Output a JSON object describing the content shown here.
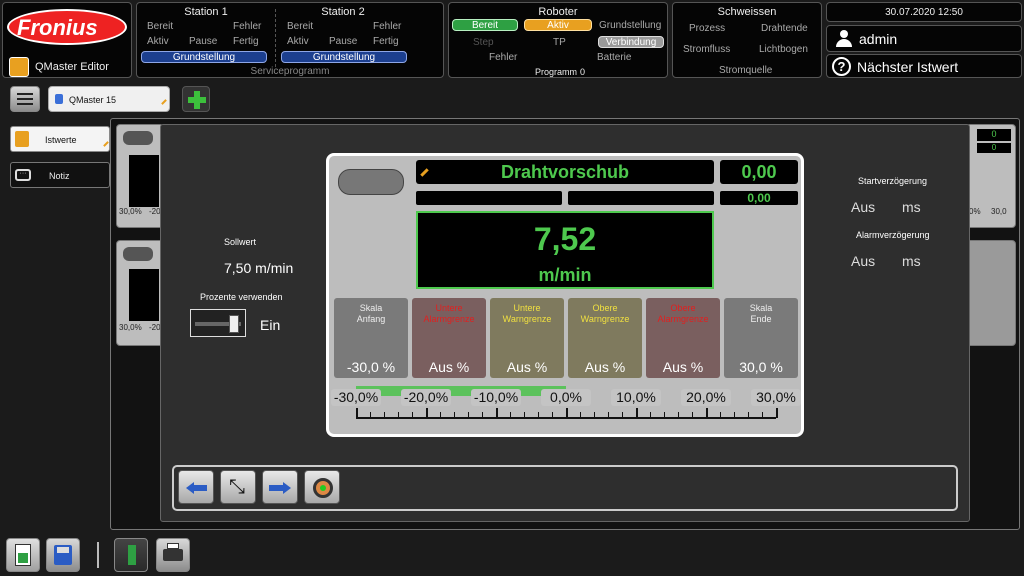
{
  "app": {
    "logo_text": "Fronius",
    "editor_label": "QMaster Editor",
    "datetime": "30.07.2020 12:50",
    "user": "admin",
    "next_actual": "Nächster Istwert"
  },
  "station1": {
    "title": "Station 1",
    "bereit": "Bereit",
    "fehler": "Fehler",
    "aktiv": "Aktiv",
    "pause": "Pause",
    "fertig": "Fertig",
    "grundstellung": "Grundstellung"
  },
  "station2": {
    "title": "Station 2",
    "bereit": "Bereit",
    "fehler": "Fehler",
    "aktiv": "Aktiv",
    "pause": "Pause",
    "fertig": "Fertig",
    "grundstellung": "Grundstellung"
  },
  "service_program": "Serviceprogramm",
  "robot": {
    "title": "Roboter",
    "bereit": "Bereit",
    "aktiv": "Aktiv",
    "grundstellung": "Grundstellung",
    "step": "Step",
    "tp": "TP",
    "verbindung": "Verbindung",
    "fehler": "Fehler",
    "programm": "Programm",
    "program_value": "0",
    "batterie": "Batterie"
  },
  "welding": {
    "title": "Schweissen",
    "prozess": "Prozess",
    "drahtende": "Drahtende",
    "stromfluss": "Stromfluss",
    "lichtbogen": "Lichtbogen",
    "stromquelle": "Stromquelle"
  },
  "tab": {
    "label": "QMaster 15"
  },
  "sidebar": {
    "items": [
      {
        "label": "Istwerte"
      },
      {
        "label": "Notiz"
      }
    ]
  },
  "bg_cards": {
    "scale_a": "30,0%",
    "scale_b": "-20",
    "scale_c": "30,0%",
    "scale_d": "-20",
    "right_a": "0",
    "right_b": "0",
    "right_scale_a": "0%",
    "right_scale_b": "30,0"
  },
  "left_settings": {
    "sollwert_label": "Sollwert",
    "sollwert_value": "7,50 m/min",
    "percent_label": "Prozente verwenden",
    "toggle_state": "Ein"
  },
  "right_settings": {
    "start_delay_label": "Startverzögerung",
    "start_value": "Aus",
    "start_unit": "ms",
    "alarm_delay_label": "Alarmverzögerung",
    "alarm_value": "Aus",
    "alarm_unit": "ms"
  },
  "gauge": {
    "title": "Drahtvorschub",
    "top_value": "0,00",
    "sub_value": "0,00",
    "value": "7,52",
    "unit": "m/min",
    "warns": [
      {
        "label1": "Skala",
        "label2": "Anfang",
        "value": "-30,0",
        "unit": "%",
        "bg": "#7a7a7a",
        "color": "#eeeeee"
      },
      {
        "label1": "Untere",
        "label2": "Alarmgrenze",
        "value": "Aus",
        "unit": "%",
        "bg": "#7a5f5f",
        "color": "#e02020"
      },
      {
        "label1": "Untere",
        "label2": "Warngrenze",
        "value": "Aus",
        "unit": "%",
        "bg": "#7f7a5e",
        "color": "#f0e040"
      },
      {
        "label1": "Obere",
        "label2": "Warngrenze",
        "value": "Aus",
        "unit": "%",
        "bg": "#7f7a5e",
        "color": "#f0e040"
      },
      {
        "label1": "Obere",
        "label2": "Alarmgrenze",
        "value": "Aus",
        "unit": "%",
        "bg": "#7a5f5f",
        "color": "#e02020"
      },
      {
        "label1": "Skala",
        "label2": "Ende",
        "value": "30,0",
        "unit": "%",
        "bg": "#7a7a7a",
        "color": "#eeeeee"
      }
    ],
    "scale_labels": [
      "-30,0%",
      "-20,0%",
      "-10,0%",
      "0,0%",
      "10,0%",
      "20,0%",
      "30,0%"
    ],
    "current_percent": 0.3,
    "colors": {
      "value_green": "#4ec94e",
      "bar_green": "#5cc25c",
      "panel": "#bdbdbd"
    }
  }
}
